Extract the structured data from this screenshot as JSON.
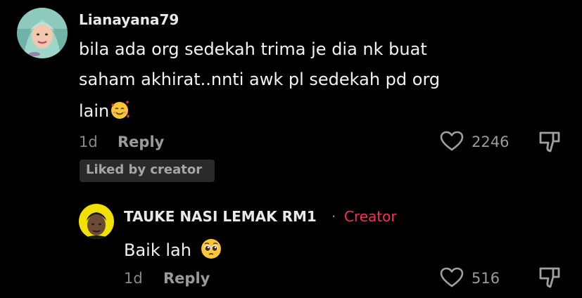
{
  "comments": [
    {
      "username": "Lianayana79",
      "text_lines": [
        "bila ada org sedekah trima je dia nk buat",
        "saham akhirat..nnti awk pl sedekah pd org",
        "lain"
      ],
      "emoji": "smiling-face-with-hearts",
      "time": "1d",
      "reply_label": "Reply",
      "likes": "2246",
      "badge": "Liked by creator"
    },
    {
      "username": "TAUKE NASI LEMAK RM1",
      "separator": "·",
      "role": "Creator",
      "text": "Baik lah",
      "emoji": "pleading-face",
      "time": "1d",
      "reply_label": "Reply",
      "likes": "516"
    }
  ],
  "colors": {
    "background": "#000000",
    "creator_accent": "#fe2c55",
    "muted": "#8a8a8a"
  }
}
